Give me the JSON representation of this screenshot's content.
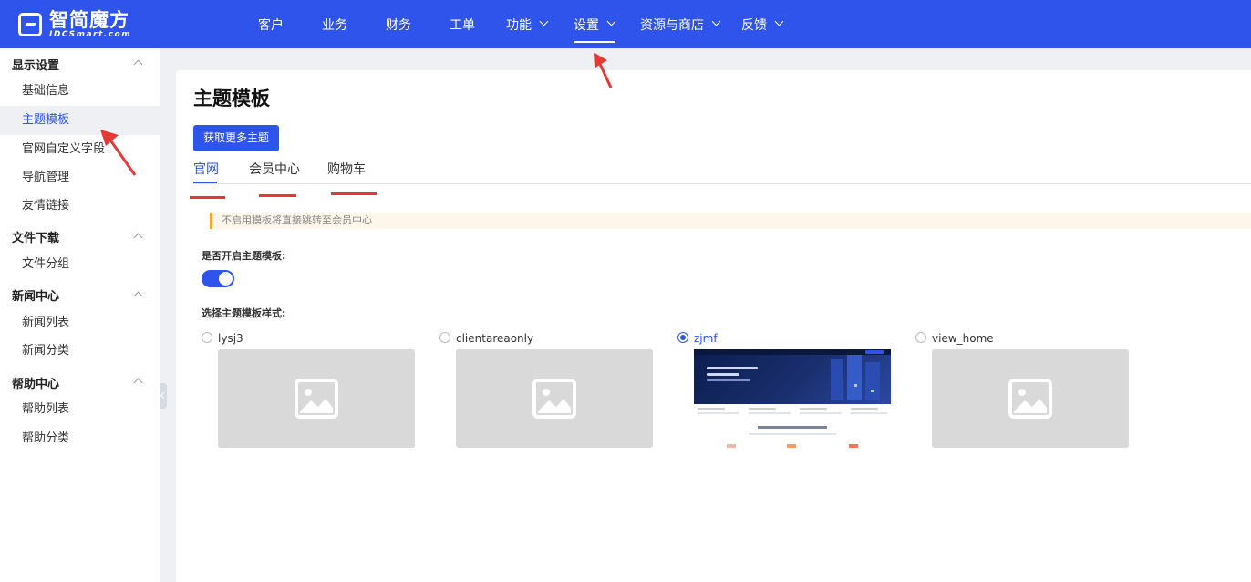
{
  "brand": {
    "name_cn": "智简魔方",
    "name_en": "IDCSmart.com"
  },
  "nav": {
    "items": [
      {
        "label": "客户"
      },
      {
        "label": "业务"
      },
      {
        "label": "财务"
      },
      {
        "label": "工单"
      },
      {
        "label": "功能"
      },
      {
        "label": "设置"
      },
      {
        "label": "资源与商店"
      },
      {
        "label": "反馈"
      }
    ],
    "active": "设置"
  },
  "sidebar": {
    "groups": [
      {
        "title": "显示设置",
        "items": [
          "基础信息",
          "主题模板",
          "官网自定义字段",
          "导航管理",
          "友情链接"
        ]
      },
      {
        "title": "文件下载",
        "items": [
          "文件分组"
        ]
      },
      {
        "title": "新闻中心",
        "items": [
          "新闻列表",
          "新闻分类"
        ]
      },
      {
        "title": "帮助中心",
        "items": [
          "帮助列表",
          "帮助分类"
        ]
      }
    ],
    "active_item": "主题模板"
  },
  "main": {
    "title": "主题模板",
    "get_more_button": "获取更多主题",
    "tabs": [
      {
        "label": "官网"
      },
      {
        "label": "会员中心"
      },
      {
        "label": "购物车"
      }
    ],
    "active_tab": "官网",
    "notice": "不启用模板将直接跳转至会员中心",
    "enable_label": "是否开启主题模板:",
    "enable_value": true,
    "style_label": "选择主题模板样式:",
    "themes": [
      {
        "name": "lysj3",
        "checked": false
      },
      {
        "name": "clientareaonly",
        "checked": false
      },
      {
        "name": "zjmf",
        "checked": true
      },
      {
        "name": "view_home",
        "checked": false
      }
    ]
  },
  "colors": {
    "primary": "#2f54eb",
    "annotation_red": "#e53935",
    "notice_border": "#f5a623"
  },
  "icons": {
    "placeholder": "image-placeholder-icon",
    "chevron": "chevron-down-icon",
    "annotation": "red-arrow-icon"
  }
}
